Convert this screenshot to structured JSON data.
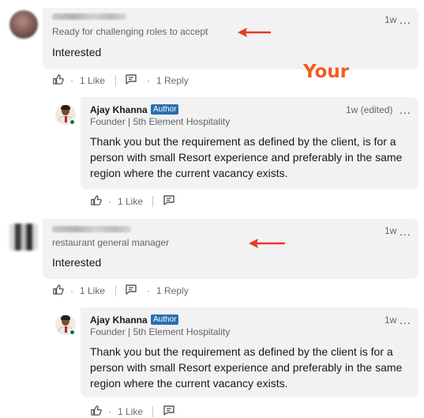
{
  "annotation": {
    "label": "Your",
    "color": "#f25b22"
  },
  "comments": [
    {
      "headline": "Ready for challenging roles to accept",
      "time": "1w",
      "more": "...",
      "text": "Interested",
      "like_text": "1 Like",
      "reply_text": "1 Reply",
      "separator": "·",
      "reply": {
        "name": "Ajay Khanna",
        "badge": "Author",
        "headline": "Founder | 5th Element Hospitality",
        "time": "1w (edited)",
        "more": "...",
        "text": "Thank you but the requirement as defined by the client, is for a person with small Resort experience and preferably in the same region where the current vacancy exists.",
        "like_text": "1 Like",
        "separator": "·"
      }
    },
    {
      "headline": "restaurant general manager",
      "time": "1w",
      "more": "...",
      "text": "Interested",
      "like_text": "1 Like",
      "reply_text": "1 Reply",
      "separator": "·",
      "reply": {
        "name": "Ajay Khanna",
        "badge": "Author",
        "headline": "Founder | 5th Element Hospitality",
        "time": "1w",
        "more": "...",
        "text": "Thank you but the requirement as defined by the client is for a person with small Resort experience and preferably in the same region where the current vacancy exists.",
        "like_text": "1 Like",
        "separator": "·"
      }
    }
  ],
  "icons": [
    "like-icon",
    "reply-icon",
    "more-icon",
    "online-status-icon",
    "arrow-icon"
  ]
}
